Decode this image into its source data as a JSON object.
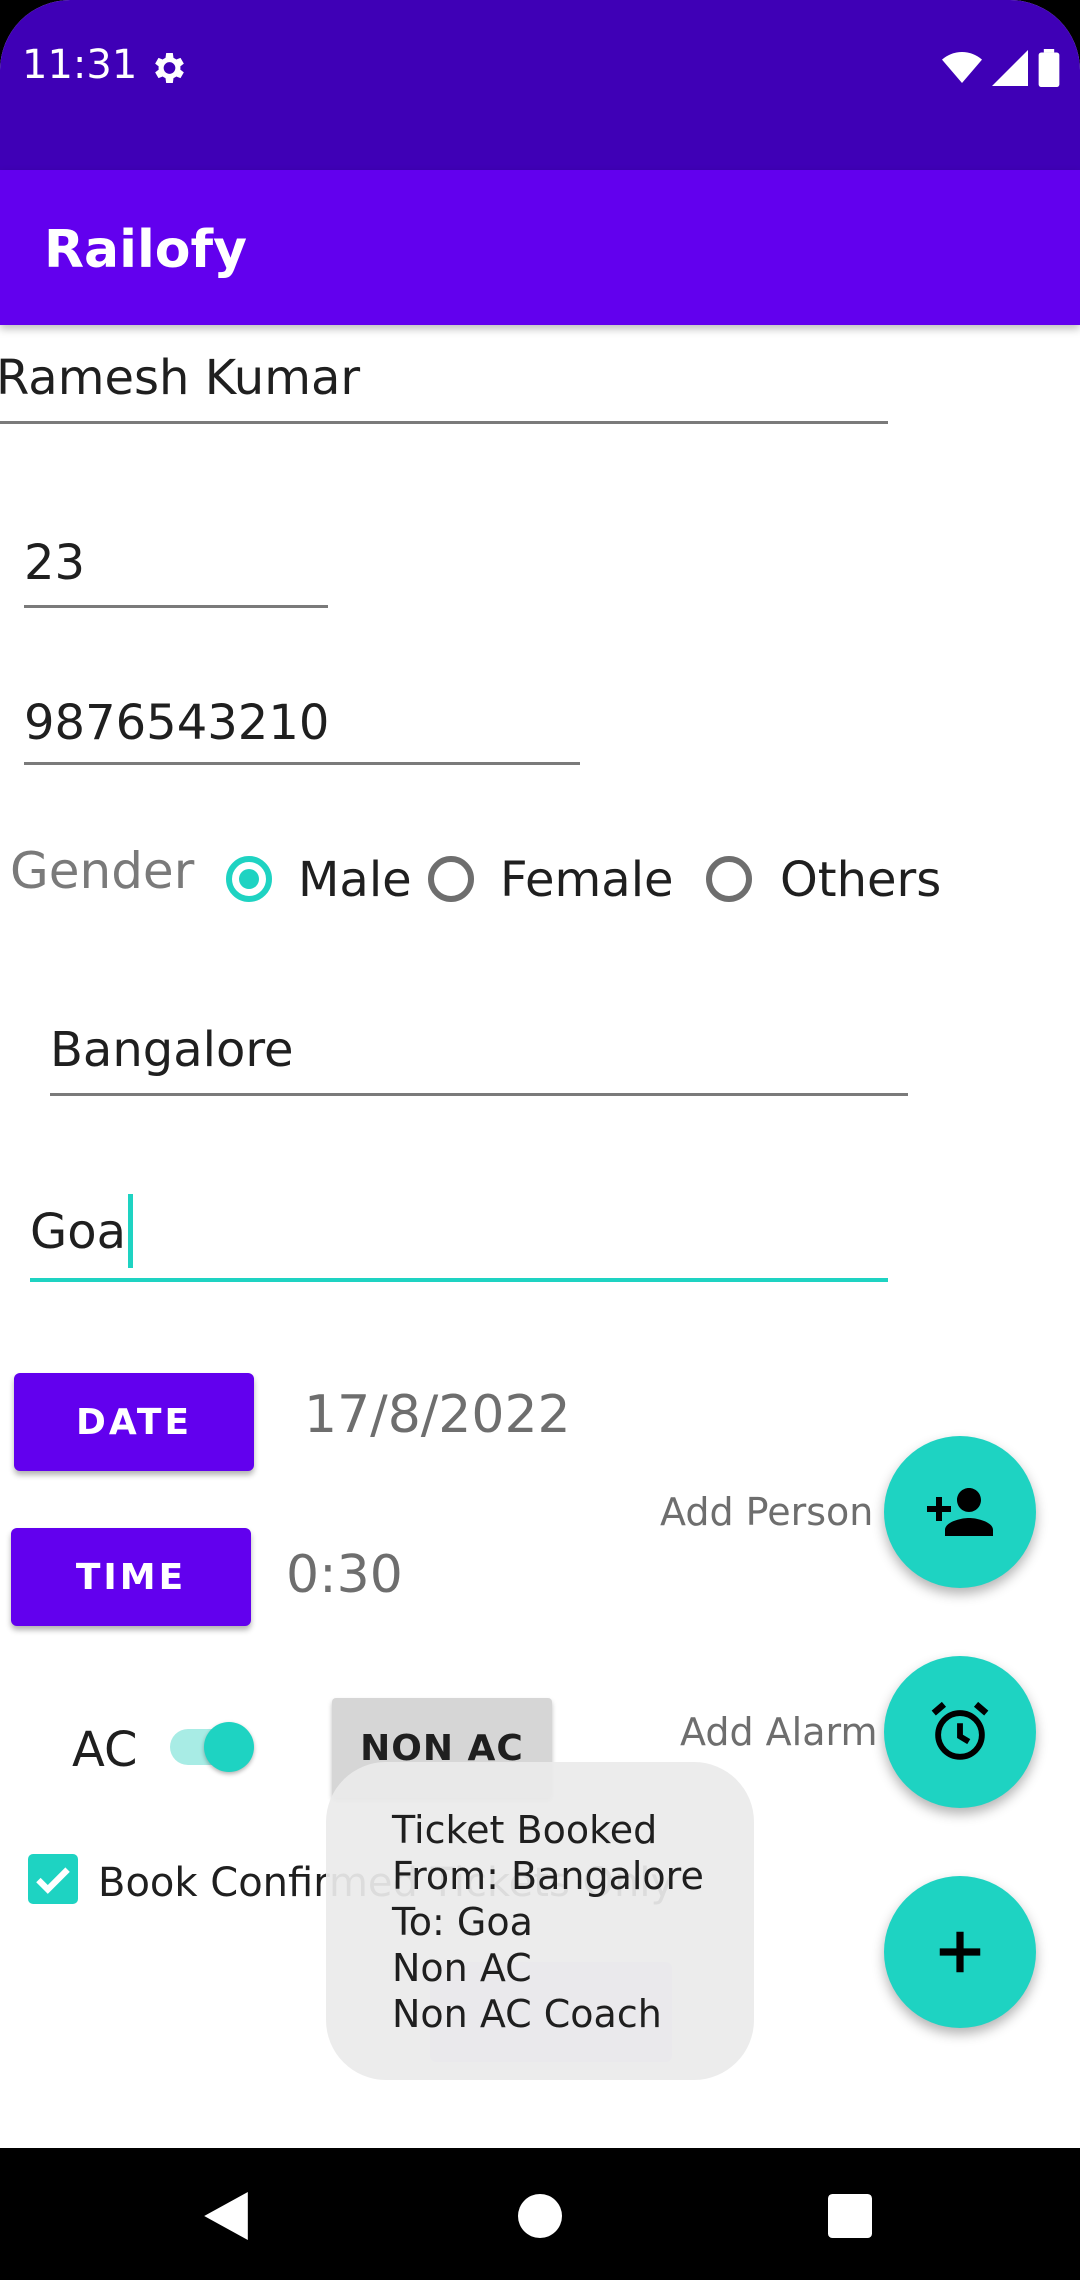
{
  "status_bar": {
    "time": "11:31",
    "icons": [
      "gear-icon",
      "wifi-icon",
      "signal-icon",
      "battery-icon"
    ]
  },
  "app_bar": {
    "title": "Railofy"
  },
  "form": {
    "name": "Ramesh Kumar",
    "age": "23",
    "phone": "9876543210",
    "gender": {
      "label": "Gender",
      "options": [
        "Male",
        "Female",
        "Others"
      ],
      "selected": "Male"
    },
    "from": "Bangalore",
    "to": "Goa"
  },
  "date": {
    "button": "DATE",
    "value": "17/8/2022"
  },
  "time": {
    "button": "TIME",
    "value": "0:30"
  },
  "ac": {
    "label": "AC",
    "switch_on": true,
    "toggle_button": "NON AC"
  },
  "confirmed": {
    "label": "Book Confirmed Tickets Only",
    "checked": true
  },
  "fabs": {
    "add_person": "Add Person",
    "add_alarm": "Add Alarm"
  },
  "toast": {
    "lines": [
      "Ticket Booked",
      "From: Bangalore",
      "To: Goa",
      "Non AC",
      "Non AC Coach"
    ]
  },
  "colors": {
    "primary": "#6200ee",
    "primary_dark": "#3f00b6",
    "accent": "#1ed3c2"
  }
}
